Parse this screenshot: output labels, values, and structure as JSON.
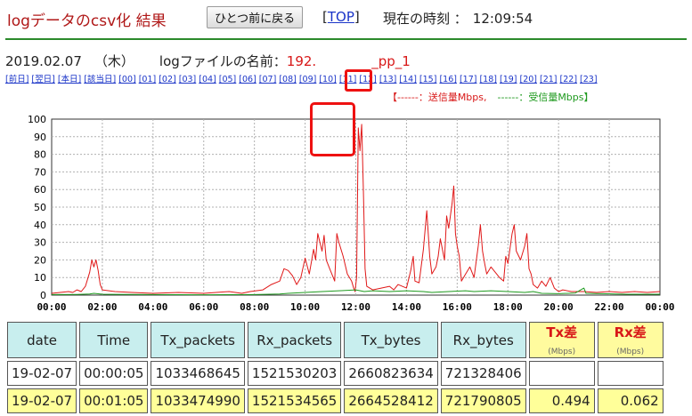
{
  "header": {
    "title": "logデータのcsv化 結果",
    "back_button": "ひとつ前に戻る",
    "top_bracket_open": "[",
    "top_link": "TOP",
    "top_bracket_close": "]",
    "time_label": "現在の時刻 ：",
    "time_value": "12:09:54"
  },
  "info": {
    "date": "2019.02.07",
    "weekday": "（木）",
    "logname_label": "logファイルの名前：",
    "ip_prefix": "192.",
    "log_suffix": "_pp_1"
  },
  "hour_links": [
    "[前日]",
    "[翌日]",
    "[本日]",
    "[該当日]",
    "[00]",
    "[01]",
    "[02]",
    "[03]",
    "[04]",
    "[05]",
    "[06]",
    "[07]",
    "[08]",
    "[09]",
    "[10]",
    "[11]",
    "[12]",
    "[13]",
    "[14]",
    "[15]",
    "[16]",
    "[17]",
    "[18]",
    "[19]",
    "[20]",
    "[21]",
    "[22]",
    "[23]"
  ],
  "legend": {
    "tx": "【------：送信量Mbps,",
    "rx": "------：受信量Mbps】"
  },
  "colors": {
    "tx": "#e01818",
    "rx": "#1f9a1f",
    "accent": "#b01818",
    "header_bg": "#c8eeee",
    "highlight": "#ffff99"
  },
  "chart_data": {
    "type": "line",
    "y_ticks": [
      "0",
      "10",
      "20",
      "30",
      "40",
      "50",
      "60",
      "70",
      "80",
      "90",
      "100"
    ],
    "x_ticks": [
      "00:00",
      "02:00",
      "04:00",
      "06:00",
      "08:00",
      "10:00",
      "12:00",
      "14:00",
      "16:00",
      "18:00",
      "20:00",
      "22:00",
      "00:00"
    ],
    "xlim": [
      0,
      1440
    ],
    "ylim": [
      0,
      100
    ],
    "grid": true,
    "series": [
      {
        "points": [
          [
            0,
            1
          ],
          [
            40,
            2
          ],
          [
            50,
            1.5
          ],
          [
            60,
            3
          ],
          [
            70,
            2
          ],
          [
            80,
            5
          ],
          [
            85,
            9
          ],
          [
            90,
            13
          ],
          [
            95,
            20
          ],
          [
            100,
            16
          ],
          [
            105,
            20
          ],
          [
            110,
            14
          ],
          [
            115,
            6
          ],
          [
            120,
            3
          ],
          [
            150,
            2
          ],
          [
            190,
            1.5
          ],
          [
            240,
            1
          ],
          [
            300,
            1.5
          ],
          [
            360,
            1
          ],
          [
            420,
            2
          ],
          [
            450,
            1
          ],
          [
            470,
            2
          ],
          [
            500,
            3
          ],
          [
            520,
            6
          ],
          [
            540,
            8
          ],
          [
            550,
            15
          ],
          [
            560,
            14
          ],
          [
            570,
            11
          ],
          [
            580,
            6
          ],
          [
            590,
            10
          ],
          [
            600,
            21
          ],
          [
            610,
            12
          ],
          [
            620,
            26
          ],
          [
            625,
            20
          ],
          [
            630,
            35
          ],
          [
            640,
            25
          ],
          [
            645,
            34
          ],
          [
            650,
            20
          ],
          [
            660,
            14
          ],
          [
            670,
            8
          ],
          [
            675,
            35
          ],
          [
            680,
            30
          ],
          [
            690,
            22
          ],
          [
            700,
            12
          ],
          [
            710,
            8
          ],
          [
            715,
            4
          ],
          [
            718,
            2
          ],
          [
            722,
            10
          ],
          [
            726,
            95
          ],
          [
            730,
            82
          ],
          [
            734,
            97
          ],
          [
            738,
            60
          ],
          [
            742,
            15
          ],
          [
            746,
            5
          ],
          [
            760,
            3
          ],
          [
            780,
            4
          ],
          [
            800,
            5
          ],
          [
            810,
            3
          ],
          [
            820,
            6
          ],
          [
            840,
            4
          ],
          [
            850,
            14
          ],
          [
            856,
            22
          ],
          [
            860,
            8
          ],
          [
            870,
            7
          ],
          [
            880,
            26
          ],
          [
            888,
            48
          ],
          [
            895,
            22
          ],
          [
            900,
            12
          ],
          [
            910,
            16
          ],
          [
            915,
            22
          ],
          [
            920,
            32
          ],
          [
            930,
            20
          ],
          [
            935,
            45
          ],
          [
            940,
            38
          ],
          [
            948,
            52
          ],
          [
            952,
            62
          ],
          [
            956,
            35
          ],
          [
            960,
            28
          ],
          [
            965,
            22
          ],
          [
            970,
            8
          ],
          [
            980,
            12
          ],
          [
            990,
            16
          ],
          [
            1000,
            10
          ],
          [
            1010,
            28
          ],
          [
            1015,
            40
          ],
          [
            1020,
            25
          ],
          [
            1025,
            18
          ],
          [
            1030,
            12
          ],
          [
            1040,
            16
          ],
          [
            1060,
            10
          ],
          [
            1070,
            8
          ],
          [
            1075,
            22
          ],
          [
            1080,
            18
          ],
          [
            1090,
            35
          ],
          [
            1095,
            40
          ],
          [
            1100,
            25
          ],
          [
            1110,
            20
          ],
          [
            1120,
            28
          ],
          [
            1125,
            35
          ],
          [
            1130,
            15
          ],
          [
            1135,
            12
          ],
          [
            1140,
            6
          ],
          [
            1150,
            4
          ],
          [
            1160,
            8
          ],
          [
            1170,
            5
          ],
          [
            1180,
            10
          ],
          [
            1190,
            4
          ],
          [
            1200,
            2
          ],
          [
            1210,
            3
          ],
          [
            1230,
            2
          ],
          [
            1260,
            2
          ],
          [
            1290,
            1.5
          ],
          [
            1320,
            2
          ],
          [
            1350,
            1.5
          ],
          [
            1380,
            2
          ],
          [
            1410,
            1.5
          ],
          [
            1440,
            2
          ]
        ]
      },
      {
        "points": [
          [
            0,
            0.3
          ],
          [
            60,
            0.4
          ],
          [
            90,
            0.6
          ],
          [
            100,
            1
          ],
          [
            120,
            0.5
          ],
          [
            240,
            0.3
          ],
          [
            360,
            0.2
          ],
          [
            480,
            0.3
          ],
          [
            540,
            0.6
          ],
          [
            560,
            1
          ],
          [
            600,
            1.5
          ],
          [
            640,
            2
          ],
          [
            680,
            2.5
          ],
          [
            720,
            3
          ],
          [
            740,
            2
          ],
          [
            760,
            2.5
          ],
          [
            800,
            2
          ],
          [
            840,
            2.5
          ],
          [
            880,
            2
          ],
          [
            900,
            1.5
          ],
          [
            940,
            2
          ],
          [
            980,
            2.5
          ],
          [
            1000,
            2
          ],
          [
            1040,
            2.5
          ],
          [
            1080,
            2
          ],
          [
            1120,
            1.5
          ],
          [
            1140,
            2
          ],
          [
            1160,
            1
          ],
          [
            1200,
            0.8
          ],
          [
            1240,
            1.2
          ],
          [
            1260,
            4
          ],
          [
            1265,
            1
          ],
          [
            1300,
            0.8
          ],
          [
            1360,
            0.5
          ],
          [
            1440,
            0.5
          ]
        ]
      }
    ]
  },
  "table": {
    "headers": [
      {
        "label": "date"
      },
      {
        "label": "Time"
      },
      {
        "label": "Tx_packets"
      },
      {
        "label": "Rx_packets"
      },
      {
        "label": "Tx_bytes"
      },
      {
        "label": "Rx_bytes"
      },
      {
        "label": "Tx差",
        "sub": "(Mbps)"
      },
      {
        "label": "Rx差",
        "sub": "(Mbps)"
      }
    ],
    "rows": [
      [
        "19-02-07",
        "00:00:05",
        "1033468645",
        "1521530203",
        "2660823634",
        "721328406",
        "",
        ""
      ],
      [
        "19-02-07",
        "00:01:05",
        "1033474990",
        "1521534565",
        "2664528412",
        "721790805",
        "0.494",
        "0.062"
      ]
    ]
  }
}
